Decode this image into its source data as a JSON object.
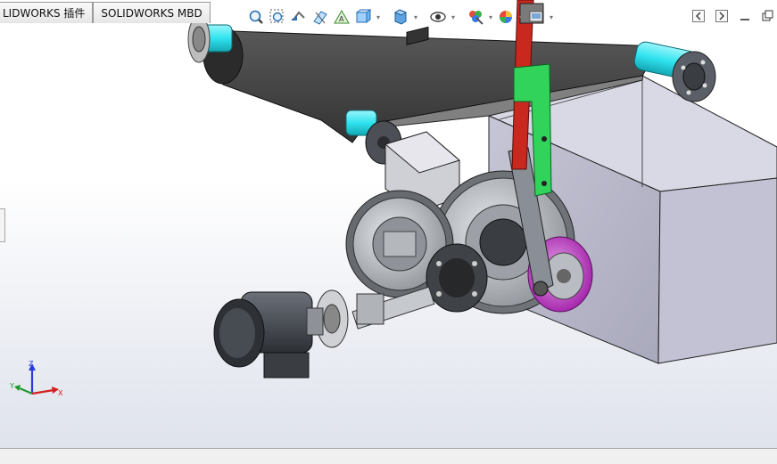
{
  "tabs": [
    {
      "label": "LIDWORKS 插件"
    },
    {
      "label": "SOLIDWORKS MBD"
    }
  ],
  "view_toolbar": {
    "icons": [
      "zoom-to-fit-icon",
      "zoom-to-area-icon",
      "previous-view-icon",
      "section-view-icon",
      "dynamic-annotation-icon",
      "view-orientation-icon",
      "display-style-icon",
      "hide-show-items-icon",
      "edit-appearance-icon",
      "apply-scene-icon",
      "view-settings-icon"
    ]
  },
  "triad": {
    "axes": [
      {
        "label": "Z",
        "color": "#2a3cd8"
      },
      {
        "label": "Y",
        "color": "#1f9a2b"
      },
      {
        "label": "X",
        "color": "#d42020"
      }
    ]
  },
  "colors": {
    "belt": "#3f3f3f",
    "roller_cyan": "#2fe3ef",
    "housing": "#b9b9cd",
    "gear": "#c2c6cc",
    "link_green": "#30d15a",
    "link_red": "#d12a22",
    "pulley_magenta": "#c230c8",
    "motor": "#4a4e56"
  }
}
